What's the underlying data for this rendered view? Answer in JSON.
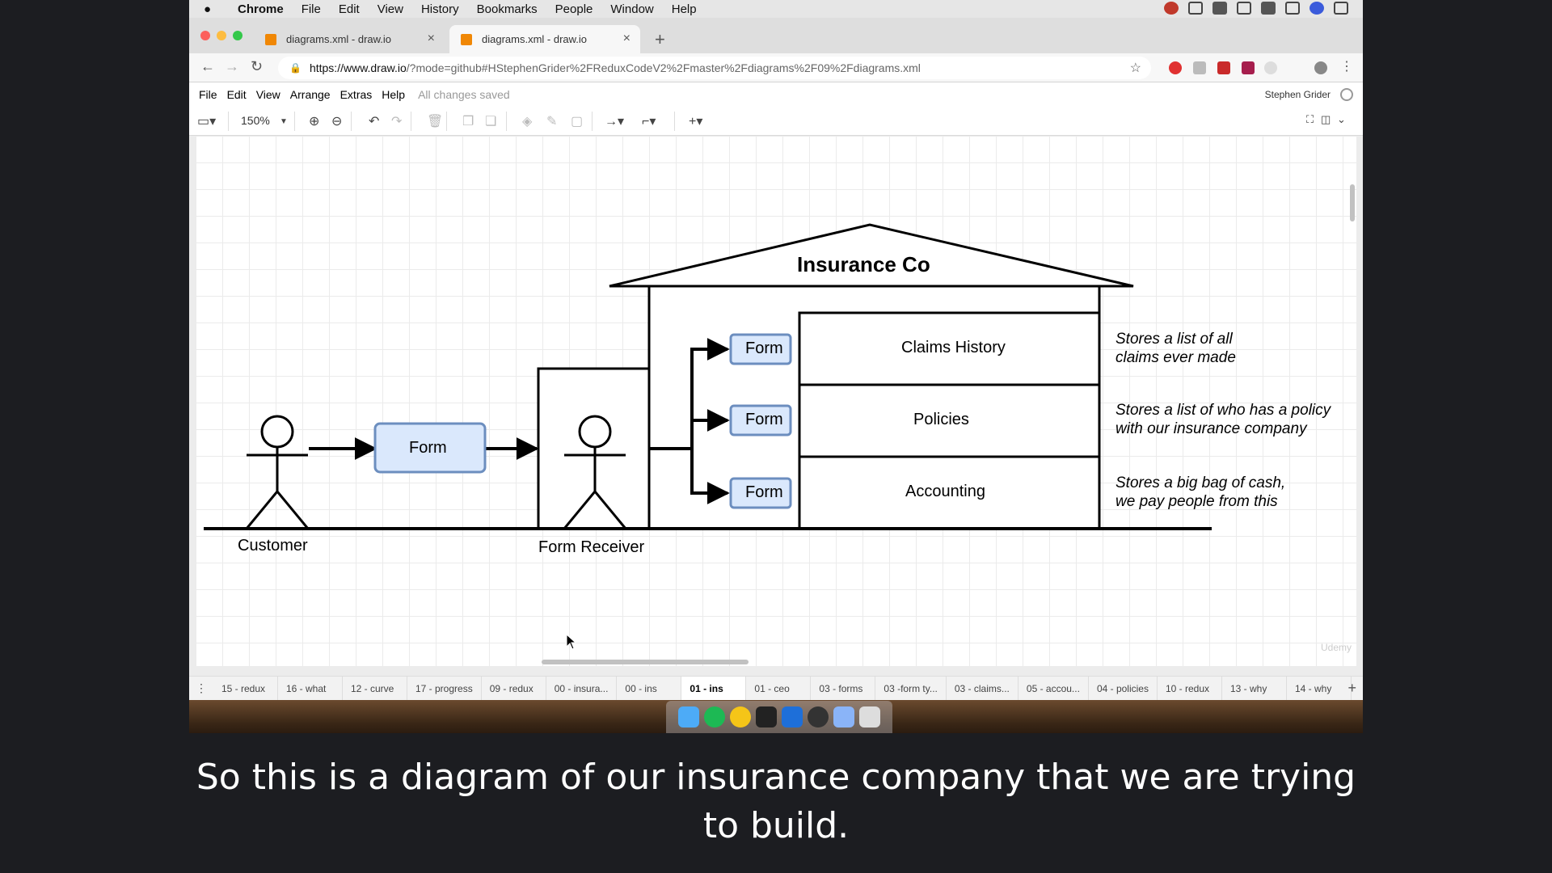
{
  "mac_menubar": {
    "app": "Chrome",
    "items": [
      "File",
      "Edit",
      "View",
      "History",
      "Bookmarks",
      "People",
      "Window",
      "Help"
    ]
  },
  "browser": {
    "tabs": [
      {
        "title": "diagrams.xml - draw.io",
        "active": false
      },
      {
        "title": "diagrams.xml - draw.io",
        "active": true
      }
    ],
    "url_host": "https://www.draw.io",
    "url_path": "/?mode=github#HStephenGrider%2FReduxCodeV2%2Fmaster%2Fdiagrams%2F09%2Fdiagrams.xml"
  },
  "drawio": {
    "menu": [
      "File",
      "Edit",
      "View",
      "Arrange",
      "Extras",
      "Help"
    ],
    "save_status": "All changes saved",
    "user": "Stephen Grider",
    "zoom": "150%"
  },
  "diagram": {
    "title": "Insurance Co",
    "customer_label": "Customer",
    "receiver_label": "Form Receiver",
    "form_label": "Form",
    "departments": [
      "Claims History",
      "Policies",
      "Accounting"
    ],
    "notes": [
      [
        "Stores a list of all",
        "claims ever made"
      ],
      [
        "Stores a list of who has a policy",
        "with our insurance company"
      ],
      [
        "Stores a big bag of cash,",
        "we pay people from this"
      ]
    ],
    "colors": {
      "form_fill": "#dae8fc",
      "form_stroke": "#6c8ebf"
    }
  },
  "pages": [
    "15 - redux",
    "16 - what",
    "12 - curve",
    "17 - progress",
    "09 - redux",
    "00 - insura...",
    "00 - ins",
    "01 - ins",
    "01 - ceo",
    "03 - forms",
    "03 -form ty...",
    "03 - claims...",
    "05 - accou...",
    "04 - policies",
    "10 - redux",
    "13 - why",
    "14 - why"
  ],
  "selected_page": "01 - ins",
  "watermark": "Udemy",
  "caption": "So this is a diagram of our insurance company that we are trying to build."
}
